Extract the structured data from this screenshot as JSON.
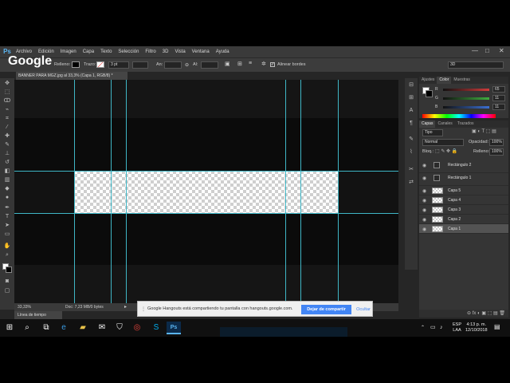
{
  "app": {
    "logo": "Ps",
    "menu": [
      "Archivo",
      "Edición",
      "Imagen",
      "Capa",
      "Texto",
      "Selección",
      "Filtro",
      "3D",
      "Vista",
      "Ventana",
      "Ayuda"
    ],
    "window_controls": [
      "—",
      "□",
      "✕"
    ]
  },
  "overlay_logo": "Google",
  "options_bar": {
    "fill_label": "Relleno:",
    "stroke_label": "Trazo:",
    "stroke_width": "3 pt",
    "width_label": "An:",
    "height_label": "Al:",
    "align_edges_label": "Alinear bordes",
    "right_value": "3D"
  },
  "document_tab": {
    "title": "BANNER PARA MGZ.jpg al 33,3% (Capa 1, RGB/8) *"
  },
  "status_bar": {
    "zoom": "33,33%",
    "doc_info": "Doc: 7,23 MB/0 bytes"
  },
  "timeline_tab": "Línea de tiempo",
  "color_panel": {
    "tabs": [
      "Ajustes",
      "Color",
      "Muestras"
    ],
    "active_tab": "Color",
    "sliders": [
      {
        "label": "R",
        "value": "65",
        "color": "#d13b3b"
      },
      {
        "label": "G",
        "value": "11",
        "color": "#3fae3f"
      },
      {
        "label": "B",
        "value": "11",
        "color": "#3b6fd1"
      }
    ]
  },
  "layers_panel": {
    "tabs": [
      "Capas",
      "Canales",
      "Trazados"
    ],
    "active_tab": "Capas",
    "filter_label": "Tipo",
    "blend_mode": "Normal",
    "opacity_label": "Opacidad:",
    "opacity_value": "100%",
    "lock_label": "Bloq.:",
    "fill_label": "Relleno:",
    "fill_value": "100%",
    "layers": [
      {
        "name": "Rectángulo 2",
        "kind": "shape",
        "selected": false
      },
      {
        "name": "Rectángulo 1",
        "kind": "shape",
        "selected": false
      },
      {
        "name": "Capa 5",
        "kind": "raster",
        "selected": false
      },
      {
        "name": "Capa 4",
        "kind": "raster",
        "selected": false
      },
      {
        "name": "Capa 3",
        "kind": "raster",
        "selected": false
      },
      {
        "name": "Capa 2",
        "kind": "raster",
        "selected": false
      },
      {
        "name": "Capa 1",
        "kind": "raster",
        "selected": true
      }
    ]
  },
  "share_bar": {
    "message": "Google Hangouts está compartiendo tu pantalla con hangouts.google.com.",
    "stop_button": "Dejar de compartir",
    "hide_button": "Ocultar"
  },
  "taskbar": {
    "language": "ESP",
    "layout": "LAA",
    "time": "4:13 p. m.",
    "date": "12/10/2018"
  },
  "colors": {
    "guide": "#3fb6c6",
    "accent": "#4285f4"
  }
}
